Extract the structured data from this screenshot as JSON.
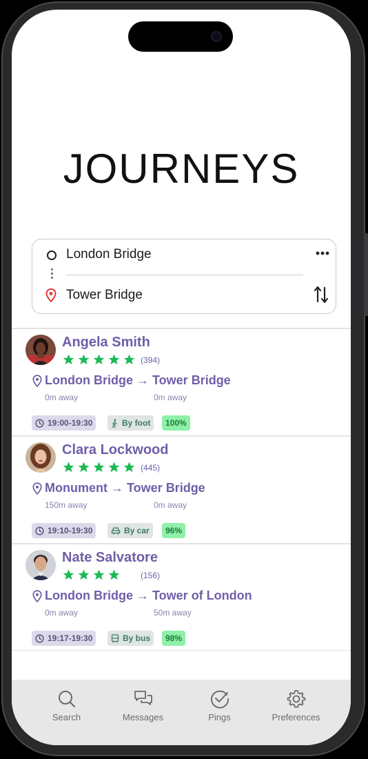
{
  "page": {
    "title": "JOURNEYS"
  },
  "search": {
    "origin": "London Bridge",
    "destination": "Tower Bridge"
  },
  "results": [
    {
      "name": "Angela Smith",
      "stars": 5,
      "rating_count": "(394)",
      "from": "London Bridge",
      "to": "Tower Bridge",
      "from_distance": "0m away",
      "to_distance": "0m away",
      "time": "19:00-19:30",
      "mode": "By foot",
      "mode_icon": "walking-icon",
      "match": "100%"
    },
    {
      "name": "Clara Lockwood",
      "stars": 5,
      "rating_count": "(445)",
      "from": "Monument",
      "to": "Tower Bridge",
      "from_distance": "150m away",
      "to_distance": "0m away",
      "time": "19:10-19:30",
      "mode": "By car",
      "mode_icon": "car-icon",
      "match": "96%"
    },
    {
      "name": "Nate Salvatore",
      "stars": 4,
      "rating_count": "(156)",
      "from": "London Bridge",
      "to": "Tower of London",
      "from_distance": "0m away",
      "to_distance": "50m away",
      "time": "19:17-19:30",
      "mode": "By bus",
      "mode_icon": "bus-icon",
      "match": "98%"
    }
  ],
  "tabs": [
    {
      "label": "Search",
      "icon": "search-icon"
    },
    {
      "label": "Messages",
      "icon": "messages-icon"
    },
    {
      "label": "Pings",
      "icon": "pings-icon"
    },
    {
      "label": "Preferences",
      "icon": "gear-icon"
    }
  ],
  "colors": {
    "accent_purple": "#6f5ea8",
    "star_green": "#1db954",
    "match_green": "#8ff0a8",
    "pin_red": "#e53935"
  }
}
